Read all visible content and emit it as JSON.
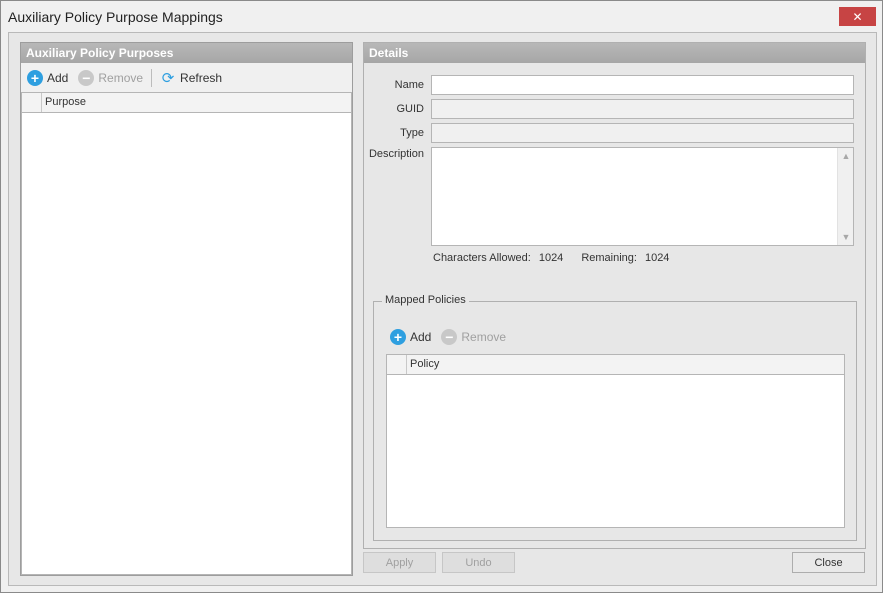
{
  "window": {
    "title": "Auxiliary Policy Purpose Mappings",
    "close_glyph": "✕"
  },
  "left_panel": {
    "header": "Auxiliary Policy Purposes",
    "toolbar": {
      "add_label": "Add",
      "remove_label": "Remove",
      "refresh_label": "Refresh"
    },
    "grid": {
      "columns": [
        "Purpose"
      ],
      "rows": []
    }
  },
  "details": {
    "header": "Details",
    "name_label": "Name",
    "name_value": "",
    "guid_label": "GUID",
    "guid_value": "",
    "type_label": "Type",
    "type_value": "",
    "description_label": "Description",
    "description_value": "",
    "chars_allowed_label": "Characters Allowed:",
    "chars_allowed_value": "1024",
    "remaining_label": "Remaining:",
    "remaining_value": "1024"
  },
  "mapped_policies": {
    "legend": "Mapped Policies",
    "toolbar": {
      "add_label": "Add",
      "remove_label": "Remove"
    },
    "grid": {
      "columns": [
        "Policy"
      ],
      "rows": []
    }
  },
  "footer": {
    "apply_label": "Apply",
    "undo_label": "Undo",
    "close_label": "Close"
  },
  "colors": {
    "accent": "#2e9fe0",
    "close_button": "#c74444",
    "panel_header": "#a6a6a6"
  },
  "icons": {
    "add": "plus-circle-icon",
    "remove": "minus-circle-icon",
    "refresh": "refresh-icon",
    "close": "close-icon"
  }
}
